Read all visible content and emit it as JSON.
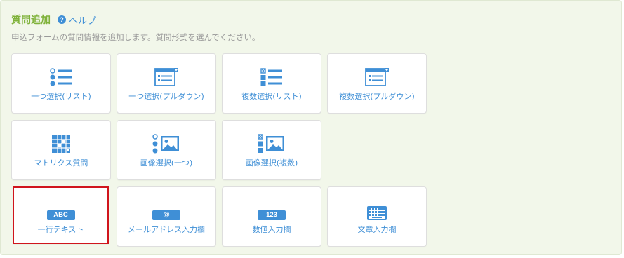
{
  "header": {
    "title": "質問追加",
    "help_badge": "?",
    "help_label": "ヘルプ"
  },
  "description": "申込フォームの質問情報を追加します。質問形式を選んでください。",
  "colors": {
    "accent_blue": "#3f8fd6",
    "title_green": "#7fb23a",
    "panel_bg": "#f2f7ea",
    "selected_border": "#d0151d"
  },
  "tiles": [
    {
      "label": "一つ選択(リスト)",
      "icon": "radio-list-icon"
    },
    {
      "label": "一つ選択(プルダウン)",
      "icon": "dropdown-single-icon"
    },
    {
      "label": "複数選択(リスト)",
      "icon": "checkbox-list-icon"
    },
    {
      "label": "複数選択(プルダウン)",
      "icon": "dropdown-multi-icon"
    },
    {
      "label": "マトリクス質問",
      "icon": "matrix-grid-icon"
    },
    {
      "label": "画像選択(一つ)",
      "icon": "image-single-select-icon"
    },
    {
      "label": "画像選択(複数)",
      "icon": "image-multi-select-icon"
    },
    {
      "label": "一行テキスト",
      "icon": "single-line-text-icon",
      "badge": "ABC",
      "selected": true
    },
    {
      "label": "メールアドレス入力欄",
      "icon": "email-at-icon",
      "badge": "@"
    },
    {
      "label": "数値入力欄",
      "icon": "number-input-icon",
      "badge": "123"
    },
    {
      "label": "文章入力欄",
      "icon": "keyboard-icon"
    }
  ]
}
